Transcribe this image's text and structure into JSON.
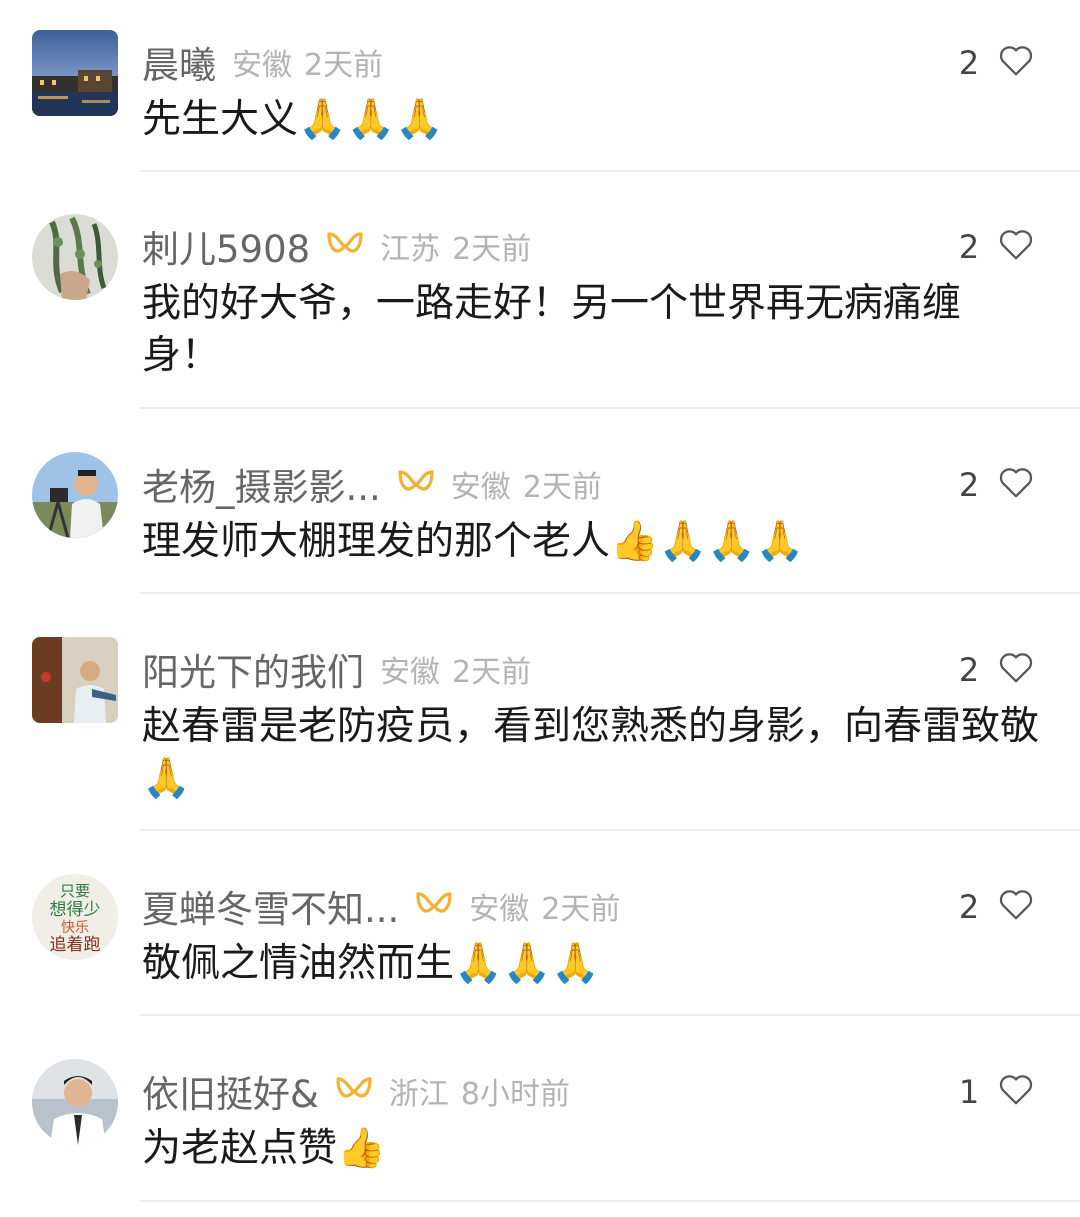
{
  "comments": [
    {
      "username": "晨曦",
      "location": "安徽",
      "time": "2天前",
      "text": "先生大义🙏🙏🙏",
      "likes": "2",
      "fan_badge": false
    },
    {
      "username": "刺儿5908",
      "location": "江苏",
      "time": "2天前",
      "text": "我的好大爷，一路走好！另一个世界再无病痛缠身！",
      "likes": "2",
      "fan_badge": true
    },
    {
      "username": "老杨_摄影影...",
      "location": "安徽",
      "time": "2天前",
      "text": "理发师大棚理发的那个老人👍🙏🙏🙏",
      "likes": "2",
      "fan_badge": true
    },
    {
      "username": "阳光下的我们",
      "location": "安徽",
      "time": "2天前",
      "text": "赵春雷是老防疫员，看到您熟悉的身影，向春雷致敬🙏",
      "likes": "2",
      "fan_badge": false
    },
    {
      "username": "夏蝉冬雪不知...",
      "location": "安徽",
      "time": "2天前",
      "text": "敬佩之情油然而生🙏🙏🙏",
      "likes": "2",
      "fan_badge": true
    },
    {
      "username": "依旧挺好&",
      "location": "浙江",
      "time": "8小时前",
      "text": "为老赵点赞👍",
      "likes": "1",
      "fan_badge": true
    }
  ],
  "avatar_text": {
    "line1": "只要",
    "line2": "想得少",
    "line3": "快乐",
    "line4": "追着跑"
  },
  "colors": {
    "username": "#666666",
    "meta": "#b3b3b3",
    "text": "#1a1a1a",
    "fan_badge": "#f2b233",
    "heart": "#555555",
    "divider": "#ececec"
  }
}
